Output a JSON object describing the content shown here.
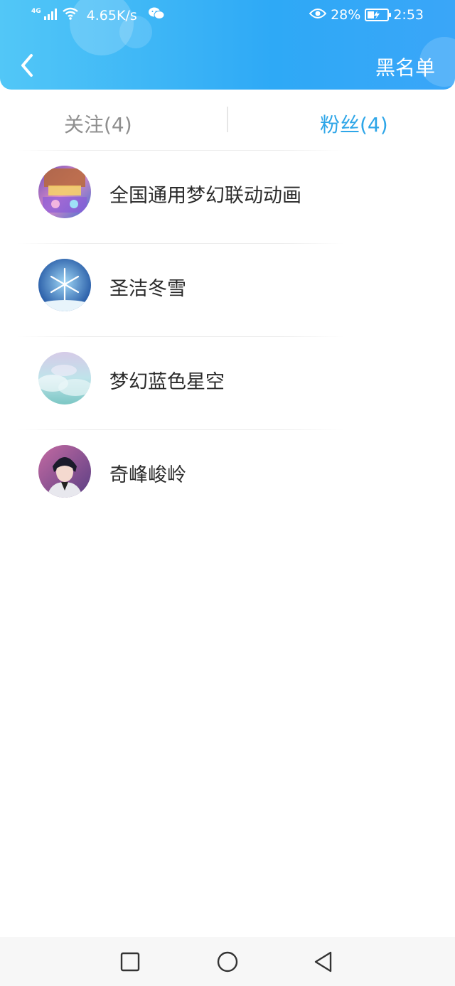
{
  "status_bar": {
    "network_type": "4G",
    "speed": "4.65K/s",
    "battery_percent": "28%",
    "time": "2:53",
    "icons": [
      "signal-icon",
      "wifi-icon",
      "wechat-icon",
      "eye-icon",
      "battery-charging-icon"
    ]
  },
  "header": {
    "back_icon": "chevron-left-icon",
    "blacklist_label": "黑名单",
    "colors": {
      "gradient_start": "#52c7f7",
      "gradient_end": "#2ea9f6"
    }
  },
  "tabs": [
    {
      "label": "关注(4)",
      "active": false
    },
    {
      "label": "粉丝(4)",
      "active": true
    }
  ],
  "accent_color": "#2ea6e8",
  "fans": [
    {
      "name": "全国通用梦幻联动动画",
      "avatar": "anime-poster-avatar"
    },
    {
      "name": "圣洁冬雪",
      "avatar": "snowflake-avatar"
    },
    {
      "name": "梦幻蓝色星空",
      "avatar": "clouds-avatar"
    },
    {
      "name": "奇峰峻岭",
      "avatar": "anime-boy-avatar"
    }
  ],
  "nav_bar": {
    "recent_icon": "square-recent-apps-icon",
    "home_icon": "circle-home-icon",
    "back_icon": "triangle-back-icon"
  }
}
